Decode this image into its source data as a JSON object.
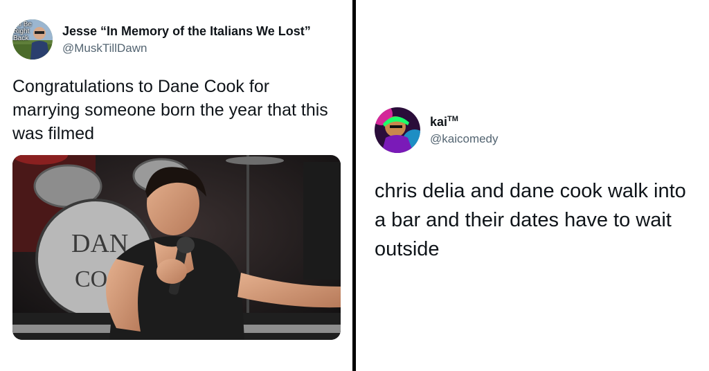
{
  "tweet1": {
    "display_name": "Jesse “In Memory of the Italians We Lost”",
    "handle": "@MuskTillDawn",
    "avatar_text": "e'll Be Right Back",
    "text": "Congratulations to Dane Cook for marrying someone born the year that this was filmed",
    "media": {
      "drum_text": "DANE COOK"
    }
  },
  "tweet2": {
    "display_name": "kai",
    "display_suffix": "TM",
    "handle": "@kaicomedy",
    "text": "chris delia and dane cook walk into a bar and their dates have to wait outside"
  },
  "colors": {
    "handle": "#536471",
    "text": "#0f1419",
    "divider": "#000000"
  }
}
